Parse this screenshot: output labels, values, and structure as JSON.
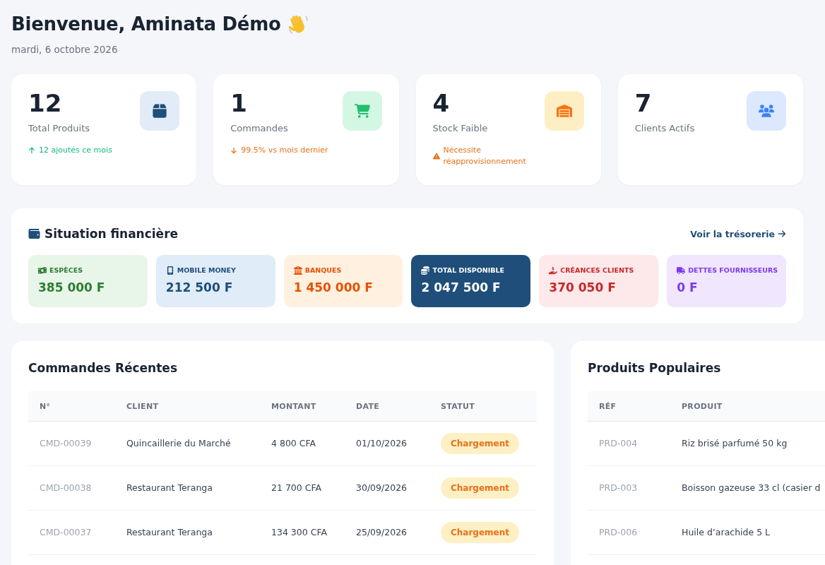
{
  "header": {
    "title": "Bienvenue, Aminata Démo",
    "date": "mardi, 6 octobre 2026"
  },
  "stats": [
    {
      "kind": "products",
      "value": "12",
      "label": "Total Produits",
      "trend": {
        "kind": "up",
        "text": "12 ajoutés ce mois"
      }
    },
    {
      "kind": "orders",
      "value": "1",
      "label": "Commandes",
      "trend": {
        "kind": "down",
        "text": "99.5% vs mois dernier"
      }
    },
    {
      "kind": "stock",
      "value": "4",
      "label": "Stock Faible",
      "trend": {
        "kind": "warning",
        "text": "Nécessite réapprovisionnement"
      }
    },
    {
      "kind": "clients",
      "value": "7",
      "label": "Clients Actifs"
    }
  ],
  "finance": {
    "title": "Situation financière",
    "link": "Voir la trésorerie",
    "tiles": [
      {
        "kind": "cash",
        "label": "ESPÈCES",
        "amount": "385 000 F"
      },
      {
        "kind": "mobile",
        "label": "MOBILE MONEY",
        "amount": "212 500 F"
      },
      {
        "kind": "bank",
        "label": "BANQUES",
        "amount": "1 450 000 F"
      },
      {
        "kind": "total",
        "label": "TOTAL DISPONIBLE",
        "amount": "2 047 500 F"
      },
      {
        "kind": "receivables",
        "label": "CRÉANCES CLIENTS",
        "amount": "370 050 F"
      },
      {
        "kind": "payables",
        "label": "DETTES FOURNISSEURS",
        "amount": "0 F"
      }
    ]
  },
  "recent_orders": {
    "title": "Commandes Récentes",
    "columns": [
      "N°",
      "CLIENT",
      "MONTANT",
      "DATE",
      "STATUT"
    ],
    "rows": [
      {
        "number": "CMD-00039",
        "client": "Quincaillerie du Marché",
        "amount": "4 800 CFA",
        "date": "01/10/2026",
        "status": "Chargement"
      },
      {
        "number": "CMD-00038",
        "client": "Restaurant Teranga",
        "amount": "21 700 CFA",
        "date": "30/09/2026",
        "status": "Chargement"
      },
      {
        "number": "CMD-00037",
        "client": "Restaurant Teranga",
        "amount": "134 300 CFA",
        "date": "25/09/2026",
        "status": "Chargement"
      }
    ]
  },
  "popular_products": {
    "title": "Produits Populaires",
    "columns": [
      "RÉF",
      "PRODUIT"
    ],
    "rows": [
      {
        "ref": "PRD-004",
        "product": "Riz brisé parfumé 50 kg"
      },
      {
        "ref": "PRD-003",
        "product": "Boisson gazeuse 33 cl (casier d"
      },
      {
        "ref": "PRD-006",
        "product": "Huile d’arachide 5 L"
      }
    ]
  }
}
